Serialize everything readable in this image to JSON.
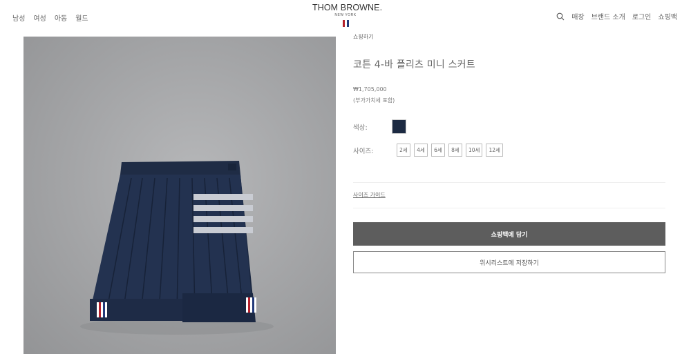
{
  "nav": {
    "left": [
      "남성",
      "여성",
      "아동",
      "월드"
    ],
    "right": [
      "매장",
      "브랜드 소개",
      "로그인",
      "쇼핑백"
    ]
  },
  "logo": {
    "main": "THOM BROWNE.",
    "sub": "NEW YORK"
  },
  "product": {
    "breadcrumb": "쇼핑하기",
    "title": "코튼 4-바 플리츠 미니 스커트",
    "price": "₩1,705,000",
    "tax_note": "(부가가치세 포함)",
    "color_label": "색상:",
    "color_swatch": "#1c2a42",
    "size_label": "사이즈:",
    "sizes": [
      "2세",
      "4세",
      "6세",
      "8세",
      "10세",
      "12세"
    ],
    "size_guide": "사이즈 가이드",
    "add_to_bag": "쇼핑백에 담기",
    "wishlist": "위시리스트에 저장하기"
  },
  "colors": {
    "navy": "#1c2a42",
    "button_dark": "#5d5d5d",
    "flag_red": "#b5202b",
    "flag_blue": "#233a7a"
  }
}
